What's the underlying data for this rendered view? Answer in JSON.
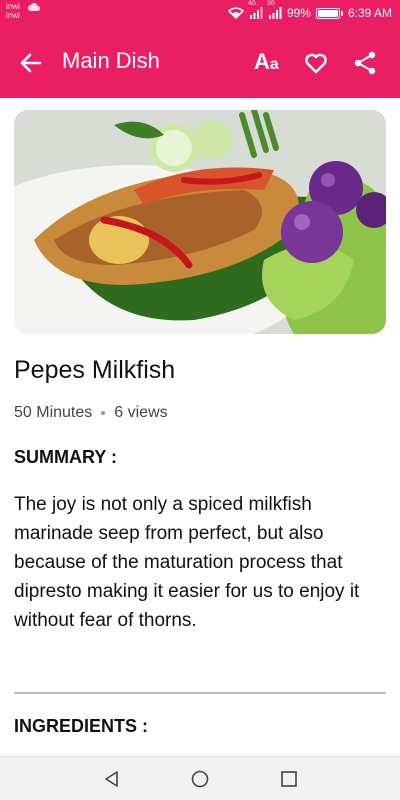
{
  "status_bar": {
    "carrier_1": "inwi",
    "carrier_2": "inwi",
    "net_1": "4G",
    "net_2": "2G",
    "battery": "99%",
    "time": "6:39 AM"
  },
  "app_bar": {
    "title": "Main Dish",
    "font_label_big": "A",
    "font_label_small": "a",
    "accent_color": "#e91e63"
  },
  "recipe": {
    "title": "Pepes Milkfish",
    "duration": "50 Minutes",
    "views": "6 views",
    "summary_heading": "SUMMARY :",
    "summary_text": "The joy is not only a spiced milkfish marinade seep from perfect, but also because of the maturation process that dipresto making it easier for us to enjoy it without fear of thorns.",
    "ingredients_heading": "INGREDIENTS :"
  },
  "icons": [
    "back-arrow-icon",
    "font-size-icon",
    "heart-icon",
    "share-icon",
    "nav-back-icon",
    "nav-home-icon",
    "nav-recent-icon"
  ]
}
